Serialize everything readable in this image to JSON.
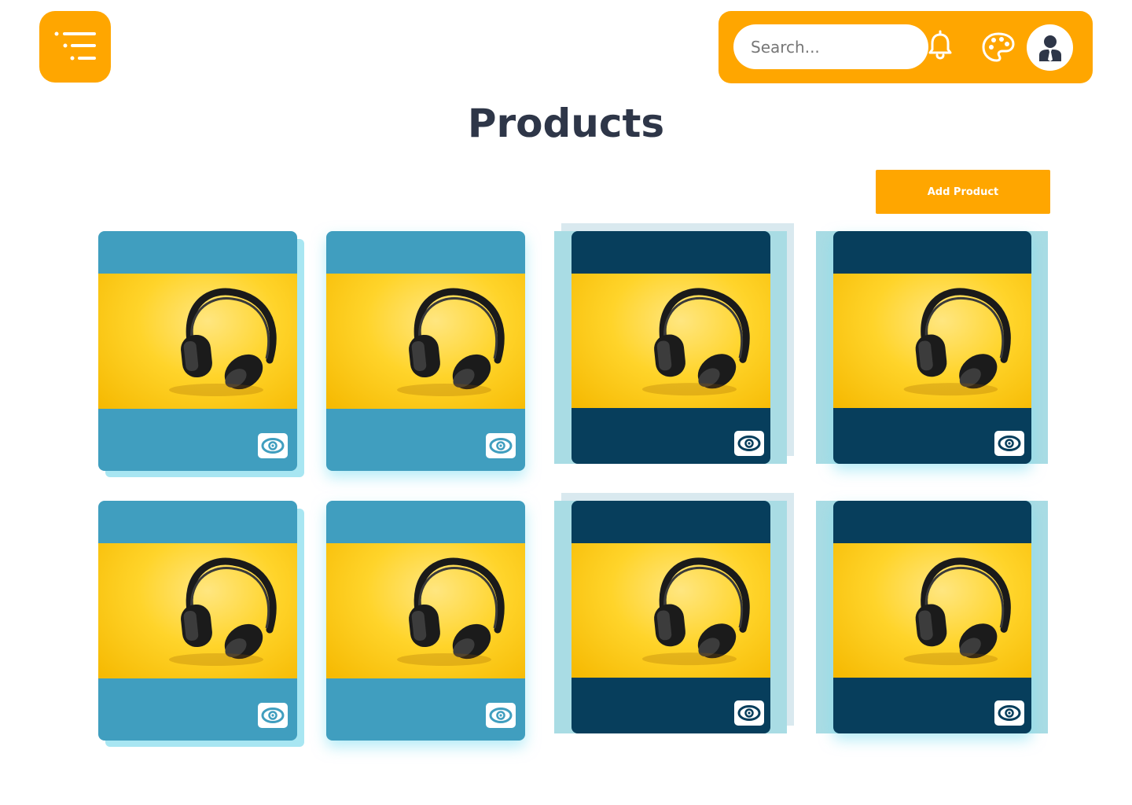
{
  "menu": {
    "icon": "menu-lines-icon"
  },
  "topbar": {
    "search_placeholder": "Search...",
    "bell_icon": "bell-icon",
    "palette_icon": "palette-icon",
    "avatar_icon": "user-avatar-icon"
  },
  "page": {
    "title": "Products"
  },
  "actions": {
    "add_product_label": "Add Product"
  },
  "colors": {
    "accent": "#FFA600",
    "title": "#2E3648",
    "card_light": "#409EBF",
    "card_dark": "#073E5C",
    "card_back_light": "#A8E6F2",
    "card_back_dark": "#A9DCE4"
  },
  "products": [
    {
      "image": "headphones-photo",
      "icon": "eye-icon"
    },
    {
      "image": "headphones-photo",
      "icon": "eye-icon"
    },
    {
      "image": "headphones-photo",
      "icon": "eye-icon"
    },
    {
      "image": "headphones-photo",
      "icon": "eye-icon"
    },
    {
      "image": "headphones-photo",
      "icon": "eye-icon"
    },
    {
      "image": "headphones-photo",
      "icon": "eye-icon"
    },
    {
      "image": "headphones-photo",
      "icon": "eye-icon"
    },
    {
      "image": "headphones-photo",
      "icon": "eye-icon"
    }
  ]
}
